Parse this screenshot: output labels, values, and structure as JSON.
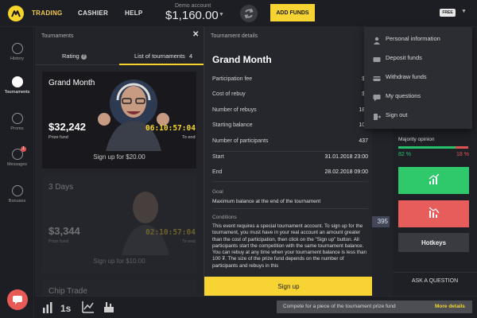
{
  "topbar": {
    "nav": [
      "TRADING",
      "CASHIER",
      "HELP"
    ],
    "account_label": "Demo account",
    "balance": "$1,160.00",
    "add_funds": "ADD FUNDS",
    "plan_badge": "FREE"
  },
  "sidebar": {
    "items": [
      {
        "label": "History",
        "icon": "history-icon"
      },
      {
        "label": "Tournaments",
        "icon": "trophy-icon"
      },
      {
        "label": "Promo",
        "icon": "percent-icon"
      },
      {
        "label": "Messages",
        "icon": "messages-icon"
      },
      {
        "label": "Bonuses",
        "icon": "bonus-icon"
      }
    ],
    "messages_badge": "1"
  },
  "tournaments_panel": {
    "title": "Tournaments",
    "tabs": {
      "rating": "Rating",
      "list": "List of tournaments",
      "list_count": "4"
    },
    "cards": [
      {
        "title": "Grand Month",
        "prize": "$32,242",
        "prize_label": "Prize fund",
        "timer": "06:10:57:04",
        "timer_label": "To end",
        "signup": "Sign up for $20.00"
      },
      {
        "title": "3 Days",
        "prize": "$3,344",
        "prize_label": "Prize fund",
        "timer": "02:10:57:04",
        "timer_label": "To end",
        "signup": "Sign up for $10.00"
      },
      {
        "title": "Chip Trade"
      }
    ]
  },
  "details_panel": {
    "title": "Tournament details",
    "name": "Grand Month",
    "rows": [
      {
        "key": "Participation fee",
        "value": "$2"
      },
      {
        "key": "Cost of rebuy",
        "value": "$2"
      },
      {
        "key": "Number of rebuys",
        "value": "186"
      },
      {
        "key": "Starting balance",
        "value": "100"
      },
      {
        "key": "Number of participants",
        "value": "437"
      },
      {
        "key": "Start",
        "value": "31.01.2018 23:00"
      },
      {
        "key": "End",
        "value": "28.02.2018 09:00"
      }
    ],
    "goal_label": "Goal",
    "goal": "Maximum balance at the end of the tournament",
    "conditions_label": "Conditions",
    "conditions": "This event requires a special tournament account. To sign up for the tournament, you must have in your real account an amount greater than the cost of participation, then click on the \"Sign up\" button. All participants start the competition with the same tournament balance. You can rebuy at any time when your tournament balance is less than 100 ₮. The size of the prize fund depends on the number of participants and rebuys in this",
    "signup": "Sign up"
  },
  "user_menu": {
    "items": [
      {
        "label": "Personal information",
        "icon": "user-icon"
      },
      {
        "label": "Deposit funds",
        "icon": "deposit-icon"
      },
      {
        "label": "Withdraw funds",
        "icon": "withdraw-icon"
      },
      {
        "label": "My questions",
        "icon": "question-icon"
      },
      {
        "label": "Sign out",
        "icon": "sign-out-icon"
      }
    ]
  },
  "trade_panel": {
    "majority_label": "Majority opinion",
    "up_pct": "82 %",
    "down_pct": "18 %",
    "up_fraction": 0.82,
    "hotkeys": "Hotkeys",
    "ask": "ASK A QUESTION"
  },
  "chart": {
    "price_tag": "395"
  },
  "bottombar": {
    "timeframe": "1s",
    "promo_text": "Compete for a piece of the tournament prize fund",
    "promo_link": "More details"
  },
  "colors": {
    "accent": "#f7d433",
    "up": "#2fc86b",
    "down": "#e75d5b",
    "badge": "#e05353"
  }
}
